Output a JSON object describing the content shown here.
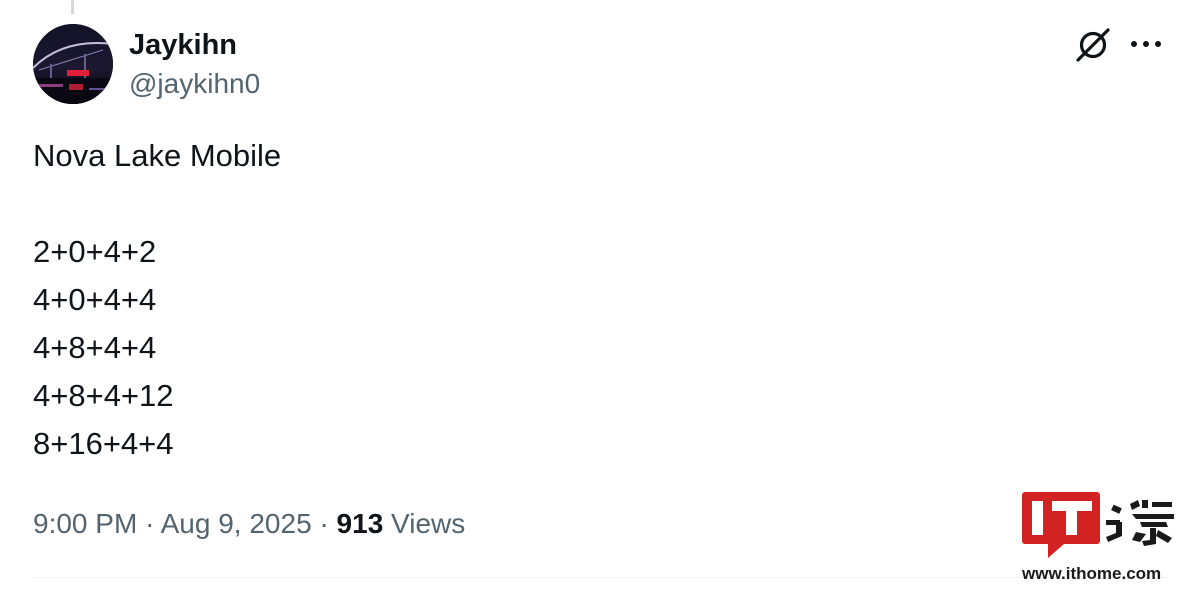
{
  "author": {
    "display_name": "Jaykihn",
    "handle": "@jaykihn0"
  },
  "header_actions": {
    "grok_icon": "grok-icon",
    "more_icon": "more-icon"
  },
  "tweet": {
    "lines": [
      "Nova Lake Mobile",
      "",
      "2+0+4+2",
      "4+0+4+4",
      "4+8+4+4",
      "4+8+4+12",
      "8+16+4+4"
    ]
  },
  "meta": {
    "time": "9:00 PM",
    "separator": "·",
    "date": "Aug 9, 2025",
    "views_count": "913",
    "views_label": "Views"
  },
  "watermark": {
    "logo_text": "IT之家",
    "url": "www.ithome.com",
    "brand_color": "#d22222"
  }
}
